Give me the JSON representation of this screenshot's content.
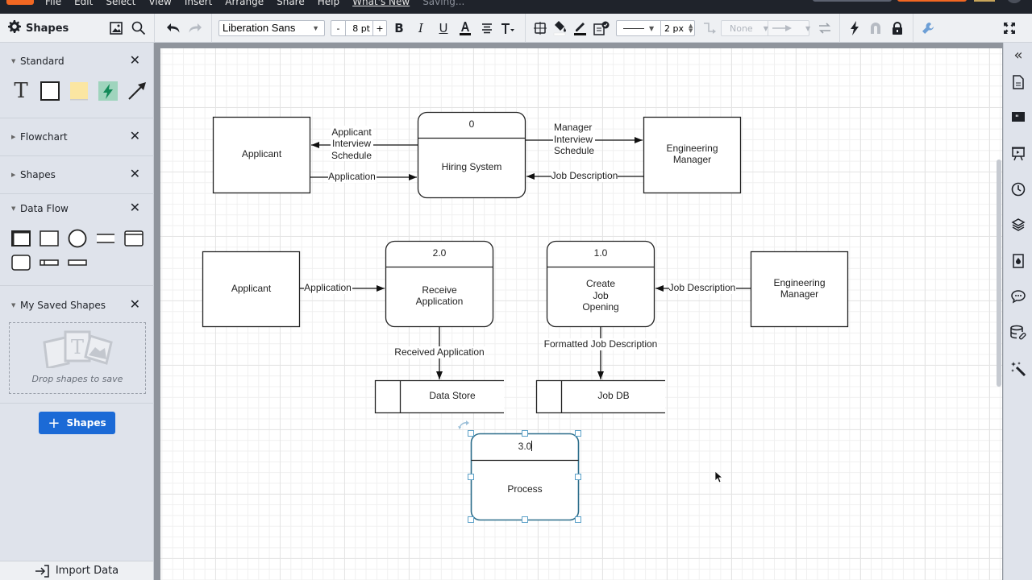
{
  "menubar": {
    "items": [
      "File",
      "Edit",
      "Select",
      "View",
      "Insert",
      "Arrange",
      "Share",
      "Help"
    ],
    "whats_new": "What's New",
    "status": "Saving..."
  },
  "toolbar": {
    "shapes_label": "Shapes",
    "font_family": "Liberation Sans",
    "font_size": "8 pt",
    "size_minus": "-",
    "size_plus": "+",
    "line_width": "2 px",
    "arrow_start": "None",
    "icons": [
      "undo-icon",
      "redo-icon",
      "bold-icon",
      "italic-icon",
      "underline-icon",
      "text-color-icon",
      "align-icon",
      "text-options-icon",
      "shape-options-icon",
      "fill-color-icon",
      "line-color-icon",
      "style-icon",
      "line-style-icon",
      "waypoint-icon",
      "arrow-end-icon",
      "swap-icon",
      "action-icon",
      "magnet-icon",
      "lock-icon",
      "wrench-icon",
      "fullscreen-icon"
    ]
  },
  "sidebar": {
    "sections": [
      {
        "title": "Standard",
        "expanded": true
      },
      {
        "title": "Flowchart",
        "expanded": false
      },
      {
        "title": "Shapes",
        "expanded": false
      },
      {
        "title": "Data Flow",
        "expanded": true
      },
      {
        "title": "My Saved Shapes",
        "expanded": true
      }
    ],
    "drop_text": "Drop shapes to save",
    "add_shapes_label": "Shapes",
    "import_label": "Import Data"
  },
  "right_rail": {
    "icons": [
      "collapse-icon",
      "page-settings-icon",
      "quote-icon",
      "presentation-icon",
      "history-icon",
      "layers-icon",
      "theme-icon",
      "comments-icon",
      "data-link-icon",
      "magic-icon"
    ]
  },
  "diagram": {
    "entities": [
      {
        "id": "applicant-1",
        "label": [
          "Applicant"
        ]
      },
      {
        "id": "eng-manager-1",
        "label": [
          "Engineering",
          "Manager"
        ]
      },
      {
        "id": "applicant-2",
        "label": [
          "Applicant"
        ]
      },
      {
        "id": "eng-manager-2",
        "label": [
          "Engineering",
          "Manager"
        ]
      }
    ],
    "processes": [
      {
        "id": "p0",
        "number": "0",
        "label": [
          "Hiring System"
        ]
      },
      {
        "id": "p2",
        "number": "2.0",
        "label": [
          "Receive",
          "Application"
        ]
      },
      {
        "id": "p1",
        "number": "1.0",
        "label": [
          "Create",
          "Job",
          "Opening"
        ]
      },
      {
        "id": "p3",
        "number": "3.0",
        "label": [
          "Process"
        ],
        "selected": true,
        "editing": true
      }
    ],
    "stores": [
      {
        "id": "s1",
        "label": "Data Store"
      },
      {
        "id": "s2",
        "label": "Job DB"
      }
    ],
    "flows": [
      {
        "from": "p0",
        "to": "applicant-1",
        "label": [
          "Applicant",
          "Interview",
          "Schedule"
        ]
      },
      {
        "from": "applicant-1",
        "to": "p0",
        "label": [
          "Application"
        ]
      },
      {
        "from": "p0",
        "to": "eng-manager-1",
        "label": [
          "Manager",
          "Interview",
          "Schedule"
        ]
      },
      {
        "from": "eng-manager-1",
        "to": "p0",
        "label": [
          "Job Description"
        ]
      },
      {
        "from": "applicant-2",
        "to": "p2",
        "label": [
          "Application"
        ]
      },
      {
        "from": "eng-manager-2",
        "to": "p1",
        "label": [
          "Job Description"
        ]
      },
      {
        "from": "p2",
        "to": "s1",
        "label": [
          "Received Application"
        ]
      },
      {
        "from": "p1",
        "to": "s2",
        "label": [
          "Formatted Job Description"
        ]
      }
    ]
  },
  "colors": {
    "accent": "#1b6ad6",
    "brand": "#f26722",
    "selection": "#2b6d8a"
  }
}
